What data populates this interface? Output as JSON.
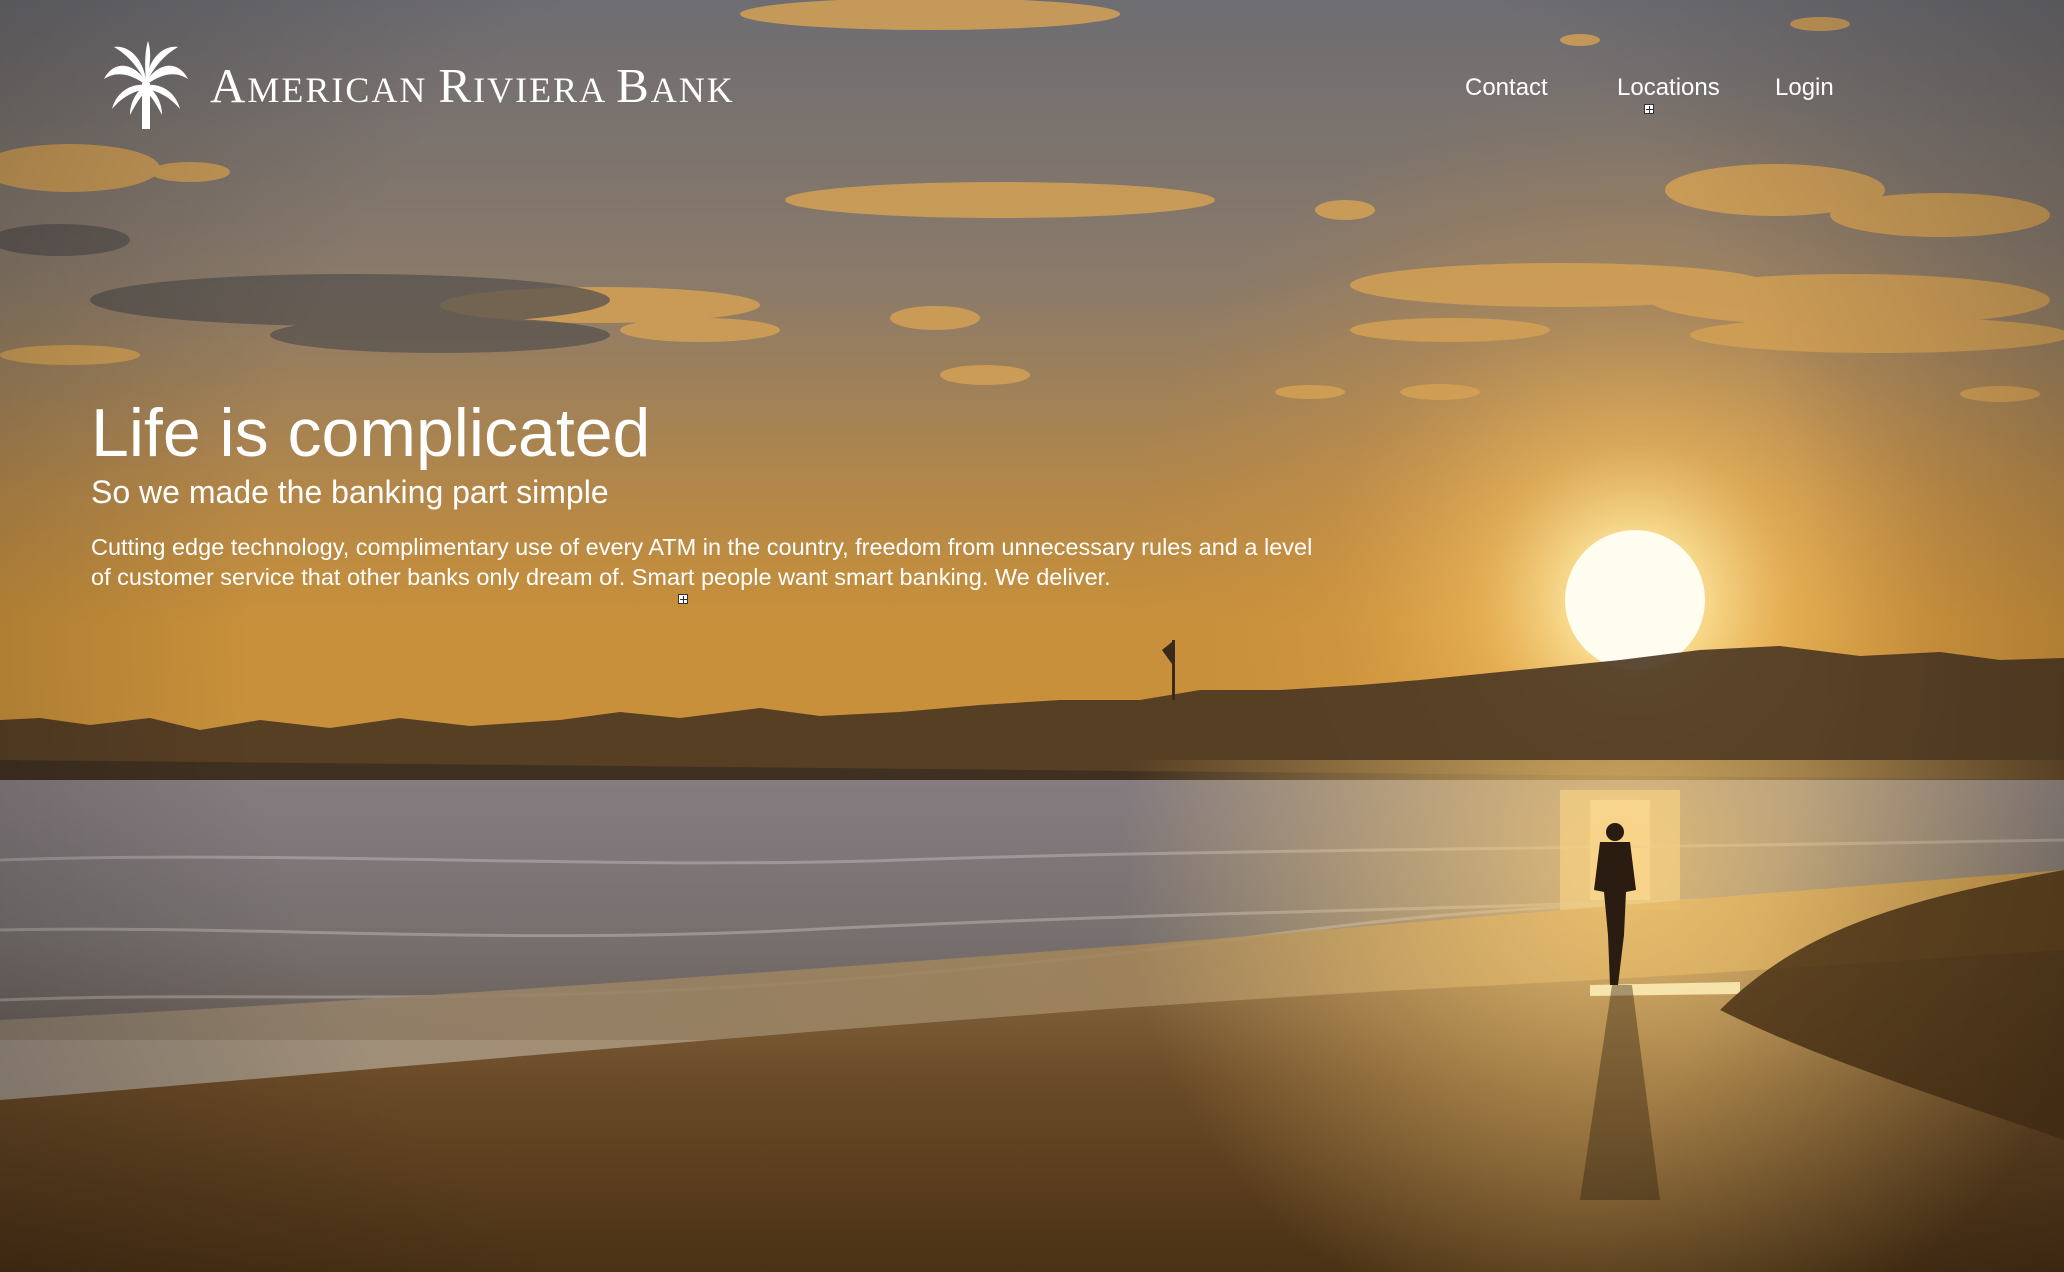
{
  "header": {
    "logo_text": "American Riviera Bank",
    "logo_icon": "palm-tree-icon"
  },
  "nav": {
    "contact": "Contact",
    "locations": "Locations",
    "login": "Login"
  },
  "hero": {
    "title": "Life is complicated",
    "subtitle": "So we made the banking part simple",
    "body": "Cutting edge technology, complimentary use of every ATM in the country, freedom from unnecessary rules and a level of customer service that other banks only dream of.  Smart people want smart banking.  We deliver."
  },
  "colors": {
    "text": "#ffffff",
    "sky_top": "#6f6f74",
    "sun": "#fff3c2",
    "sand": "#5a3d1e",
    "water": "#7c7270"
  }
}
